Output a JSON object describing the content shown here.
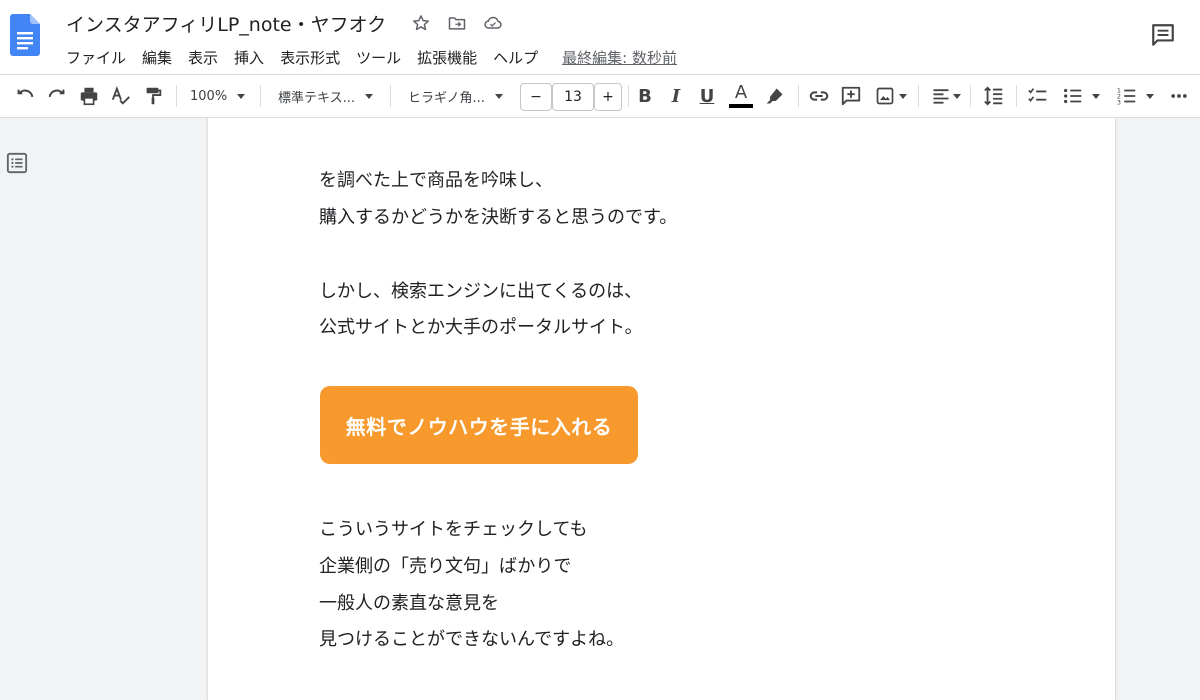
{
  "doc": {
    "title": "インスタアフィリLP_note・ヤフオク",
    "last_edit": "最終編集: 数秒前"
  },
  "menu": {
    "items": [
      "ファイル",
      "編集",
      "表示",
      "挿入",
      "表示形式",
      "ツール",
      "拡張機能",
      "ヘルプ"
    ]
  },
  "toolbar": {
    "zoom": "100%",
    "style": "標準テキス...",
    "font": "ヒラギノ角...",
    "font_size_minus": "−",
    "font_size": "13",
    "font_size_plus": "+",
    "bold": "B",
    "italic": "I",
    "underline": "U",
    "text_color_letter": "A"
  },
  "document": {
    "lines": [
      "を調べた上で商品を吟味し、",
      "購入するかどうかを決断すると思うのです。",
      "しかし、検索エンジンに出てくるのは、",
      "公式サイトとか大手のポータルサイト。",
      "こういうサイトをチェックしても",
      "企業側の「売り文句」ばかりで",
      "一般人の素直な意見を",
      "見つけることができないんですよね。"
    ],
    "cta_label": "無料でノウハウを手に入れる"
  },
  "colors": {
    "cta": "#f7992d",
    "docs_blue": "#4285f4"
  }
}
